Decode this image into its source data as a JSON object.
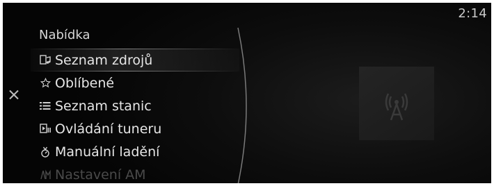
{
  "status": {
    "time": "2:14"
  },
  "menu": {
    "title": "Nabídka",
    "items": [
      {
        "label": "Seznam zdrojů",
        "icon": "source-list-icon",
        "selected": true
      },
      {
        "label": "Oblíbené",
        "icon": "star-icon"
      },
      {
        "label": "Seznam stanic",
        "icon": "list-icon"
      },
      {
        "label": "Ovládání tuneru",
        "icon": "tuner-control-icon"
      },
      {
        "label": "Manuální ladění",
        "icon": "manual-tuning-icon"
      },
      {
        "label": "Nastavení AM",
        "icon": "am-settings-icon",
        "dimmed": true
      }
    ]
  },
  "artwork": {
    "icon": "radio-tower-icon"
  }
}
